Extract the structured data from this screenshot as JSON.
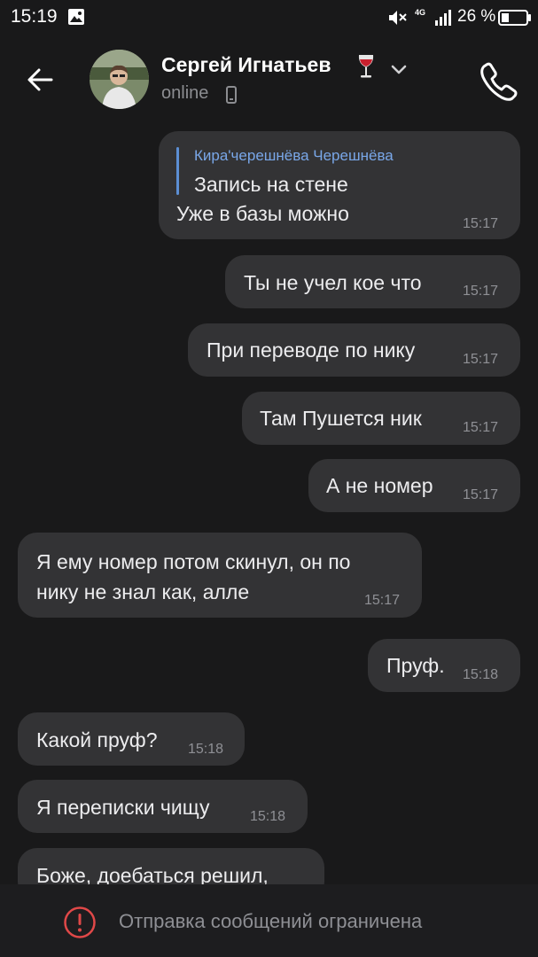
{
  "status_bar": {
    "time": "15:19",
    "network": "4G",
    "battery": "26 %"
  },
  "header": {
    "contact_name": "Сергей Игнатьев",
    "status": "online",
    "icons": [
      "arrow-left-icon",
      "avatar",
      "wine-glass-icon",
      "chevron-down-icon",
      "mobile-phone-icon",
      "phone-call-icon"
    ]
  },
  "messages": [
    {
      "dir": "out",
      "reply_author": "Кира'черешнёва Черешнёва",
      "reply_text": "Запись на стене",
      "text": "Уже в базы можно",
      "time": "15:17"
    },
    {
      "dir": "out",
      "text": "Ты не учел кое что",
      "time": "15:17"
    },
    {
      "dir": "out",
      "text": "При переводе по нику",
      "time": "15:17"
    },
    {
      "dir": "out",
      "text": "Там Пушется ник",
      "time": "15:17"
    },
    {
      "dir": "out",
      "text": "А не номер",
      "time": "15:17"
    },
    {
      "dir": "in",
      "lines": [
        "Я ему номер потом скинул, он по",
        "нику не знал как, алле"
      ],
      "time": "15:17"
    },
    {
      "dir": "out",
      "text": "Пруф.",
      "time": "15:18"
    },
    {
      "dir": "in",
      "text": "Какой пруф?",
      "time": "15:18"
    },
    {
      "dir": "in",
      "text": "Я переписки чищу",
      "time": "15:18"
    },
    {
      "dir": "in",
      "text": "Боже, доебаться решил,",
      "time": ""
    }
  ],
  "footer": {
    "restricted_text": "Отправка сообщений ограничена"
  },
  "colors": {
    "background": "#19191a",
    "bubble": "#333335",
    "reply_accent": "#79a7e8",
    "warning": "#e04848"
  }
}
